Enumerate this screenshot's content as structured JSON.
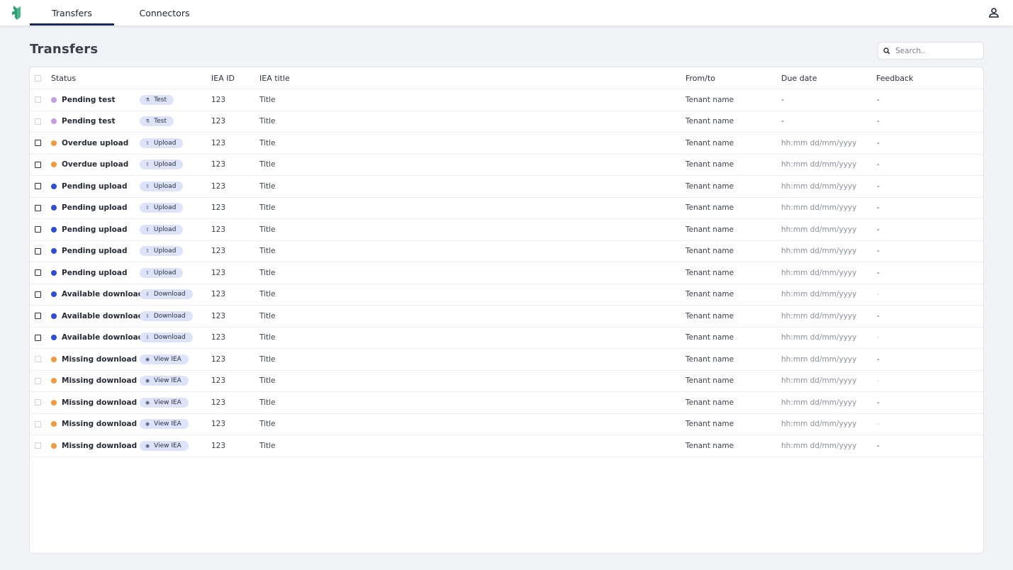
{
  "nav": {
    "logo_icon": "app-logo-icon",
    "tabs": [
      {
        "label": "Transfers",
        "active": true
      },
      {
        "label": "Connectors",
        "active": false
      }
    ],
    "user_icon": "user-icon"
  },
  "page": {
    "title": "Transfers"
  },
  "search": {
    "placeholder": "Search..",
    "value": ""
  },
  "colors": {
    "accent": "#1b2a59",
    "pending_test": "#c79be6",
    "overdue": "#f59a3c",
    "pending": "#2d4ed8",
    "missing": "#f59a3c",
    "badge_bg": "#dde3fb"
  },
  "table": {
    "columns": {
      "status": "Status",
      "iea_id": "IEA ID",
      "iea_title": "IEA title",
      "from_to": "From/to",
      "due_date": "Due date",
      "feedback": "Feedback"
    },
    "rows": [
      {
        "status": "Pending test",
        "dot": "pending_test",
        "action": "Test",
        "action_icon": "test-tube-icon",
        "id": "123",
        "title": "Title",
        "from": "Tenant name",
        "due": "-",
        "feedback": "-",
        "checkbox": "faint"
      },
      {
        "status": "Pending test",
        "dot": "pending_test",
        "action": "Test",
        "action_icon": "test-tube-icon",
        "id": "123",
        "title": "Title",
        "from": "Tenant name",
        "due": "-",
        "feedback": "-",
        "checkbox": "faint"
      },
      {
        "status": "Overdue upload",
        "dot": "overdue",
        "action": "Upload",
        "action_icon": "upload-icon",
        "id": "123",
        "title": "Title",
        "from": "Tenant name",
        "due": "hh:mm dd/mm/yyyy",
        "feedback": "-",
        "checkbox": "normal"
      },
      {
        "status": "Overdue upload",
        "dot": "overdue",
        "action": "Upload",
        "action_icon": "upload-icon",
        "id": "123",
        "title": "Title",
        "from": "Tenant name",
        "due": "hh:mm dd/mm/yyyy",
        "feedback": "-",
        "checkbox": "normal"
      },
      {
        "status": "Pending upload",
        "dot": "pending",
        "action": "Upload",
        "action_icon": "upload-icon",
        "id": "123",
        "title": "Title",
        "from": "Tenant name",
        "due": "hh:mm dd/mm/yyyy",
        "feedback": "-",
        "checkbox": "normal"
      },
      {
        "status": "Pending upload",
        "dot": "pending",
        "action": "Upload",
        "action_icon": "upload-icon",
        "id": "123",
        "title": "Title",
        "from": "Tenant name",
        "due": "hh:mm dd/mm/yyyy",
        "feedback": "-",
        "checkbox": "normal"
      },
      {
        "status": "Pending upload",
        "dot": "pending",
        "action": "Upload",
        "action_icon": "upload-icon",
        "id": "123",
        "title": "Title",
        "from": "Tenant name",
        "due": "hh:mm dd/mm/yyyy",
        "feedback": "-",
        "checkbox": "normal"
      },
      {
        "status": "Pending upload",
        "dot": "pending",
        "action": "Upload",
        "action_icon": "upload-icon",
        "id": "123",
        "title": "Title",
        "from": "Tenant name",
        "due": "hh:mm dd/mm/yyyy",
        "feedback": "-",
        "checkbox": "normal"
      },
      {
        "status": "Pending upload",
        "dot": "pending",
        "action": "Upload",
        "action_icon": "upload-icon",
        "id": "123",
        "title": "Title",
        "from": "Tenant name",
        "due": "hh:mm dd/mm/yyyy",
        "feedback": "-",
        "checkbox": "normal"
      },
      {
        "status": "Available download",
        "dot": "pending",
        "action": "Download",
        "action_icon": "download-icon",
        "id": "123",
        "title": "Title",
        "from": "Tenant name",
        "due": "hh:mm dd/mm/yyyy",
        "feedback": "-",
        "checkbox": "normal",
        "feedback_faint": true
      },
      {
        "status": "Available download",
        "dot": "pending",
        "action": "Download",
        "action_icon": "download-icon",
        "id": "123",
        "title": "Title",
        "from": "Tenant name",
        "due": "hh:mm dd/mm/yyyy",
        "feedback": "-",
        "checkbox": "normal"
      },
      {
        "status": "Available download",
        "dot": "pending",
        "action": "Download",
        "action_icon": "download-icon",
        "id": "123",
        "title": "Title",
        "from": "Tenant name",
        "due": "hh:mm dd/mm/yyyy",
        "feedback": "-",
        "checkbox": "normal",
        "feedback_faint": true
      },
      {
        "status": "Missing download",
        "dot": "missing",
        "action": "View IEA",
        "action_icon": "eye-icon",
        "id": "123",
        "title": "Title",
        "from": "Tenant name",
        "due": "hh:mm dd/mm/yyyy",
        "feedback": "-",
        "checkbox": "faint"
      },
      {
        "status": "Missing download",
        "dot": "missing",
        "action": "View IEA",
        "action_icon": "eye-icon",
        "id": "123",
        "title": "Title",
        "from": "Tenant name",
        "due": "hh:mm dd/mm/yyyy",
        "feedback": "-",
        "checkbox": "faint",
        "feedback_faint": true
      },
      {
        "status": "Missing download",
        "dot": "missing",
        "action": "View IEA",
        "action_icon": "eye-icon",
        "id": "123",
        "title": "Title",
        "from": "Tenant name",
        "due": "hh:mm dd/mm/yyyy",
        "feedback": "-",
        "checkbox": "faint"
      },
      {
        "status": "Missing download",
        "dot": "missing",
        "action": "View IEA",
        "action_icon": "eye-icon",
        "id": "123",
        "title": "Title",
        "from": "Tenant name",
        "due": "hh:mm dd/mm/yyyy",
        "feedback": "-",
        "checkbox": "faint",
        "feedback_faint": true
      },
      {
        "status": "Missing download",
        "dot": "missing",
        "action": "View IEA",
        "action_icon": "eye-icon",
        "id": "123",
        "title": "Title",
        "from": "Tenant name",
        "due": "hh:mm dd/mm/yyyy",
        "feedback": "-",
        "checkbox": "faint"
      }
    ]
  }
}
